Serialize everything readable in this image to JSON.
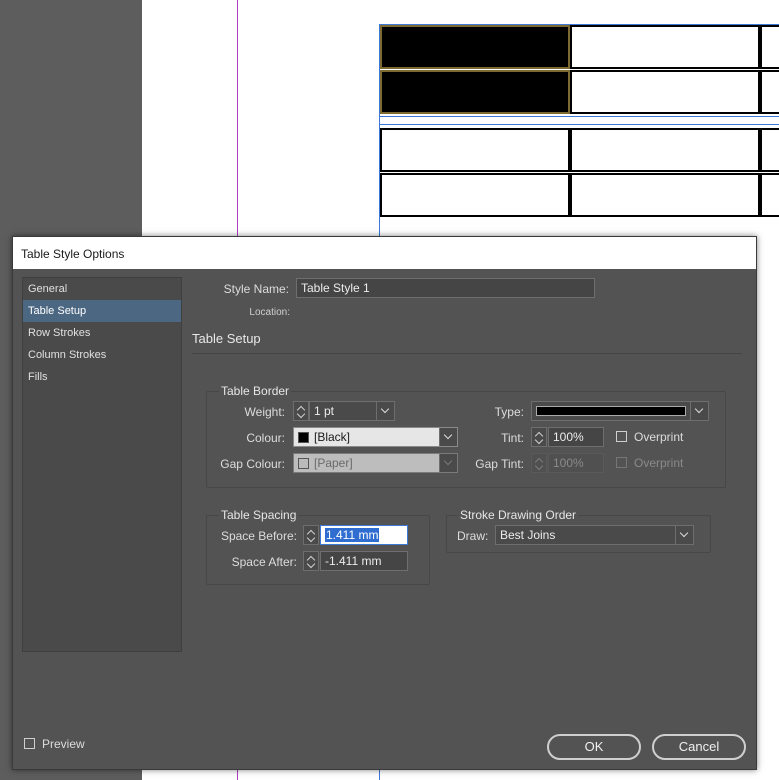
{
  "dialog": {
    "title": "Table Style Options",
    "sidebar": [
      {
        "label": "General",
        "active": false
      },
      {
        "label": "Table Setup",
        "active": true
      },
      {
        "label": "Row Strokes",
        "active": false
      },
      {
        "label": "Column Strokes",
        "active": false
      },
      {
        "label": "Fills",
        "active": false
      }
    ],
    "style_name_label": "Style Name:",
    "style_name_value": "Table Style 1",
    "location_label": "Location:",
    "section_title": "Table Setup",
    "table_border": {
      "title": "Table Border",
      "weight_label": "Weight:",
      "weight_value": "1 pt",
      "type_label": "Type:",
      "colour_label": "Colour:",
      "colour_value": "[Black]",
      "tint_label": "Tint:",
      "tint_value": "100%",
      "overprint_label": "Overprint",
      "gap_colour_label": "Gap Colour:",
      "gap_colour_value": "[Paper]",
      "gap_tint_label": "Gap Tint:",
      "gap_tint_value": "100%",
      "gap_overprint_label": "Overprint"
    },
    "table_spacing": {
      "title": "Table Spacing",
      "space_before_label": "Space Before:",
      "space_before_value": "1.411 mm",
      "space_after_label": "Space After:",
      "space_after_value": "-1.411 mm"
    },
    "stroke_order": {
      "title": "Stroke Drawing Order",
      "draw_label": "Draw:",
      "draw_value": "Best Joins"
    },
    "preview_label": "Preview",
    "ok_label": "OK",
    "cancel_label": "Cancel"
  },
  "colors": {
    "swatch_black": "#000000",
    "swatch_paper": "#bbbbbb",
    "accent": "#4c6782"
  }
}
